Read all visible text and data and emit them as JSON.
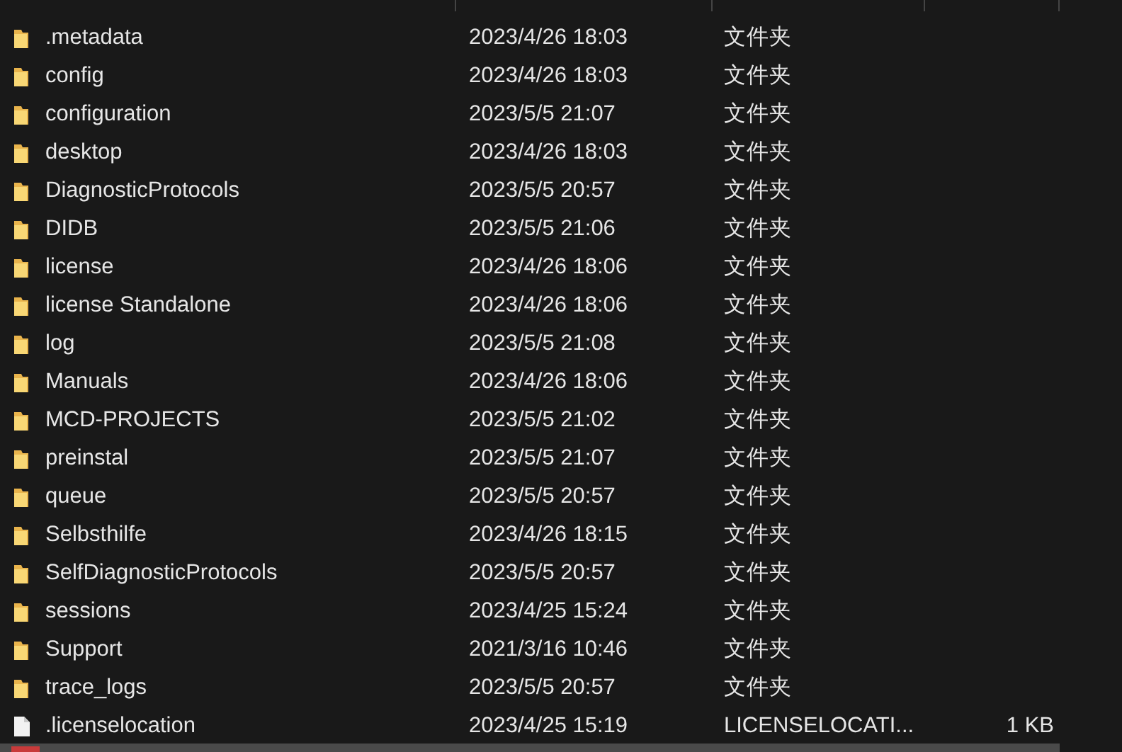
{
  "files": [
    {
      "kind": "folder",
      "name": ".metadata",
      "modified": "2023/4/26 18:03",
      "type": "文件夹"
    },
    {
      "kind": "folder",
      "name": "config",
      "modified": "2023/4/26 18:03",
      "type": "文件夹"
    },
    {
      "kind": "folder",
      "name": "configuration",
      "modified": "2023/5/5 21:07",
      "type": "文件夹"
    },
    {
      "kind": "folder",
      "name": "desktop",
      "modified": "2023/4/26 18:03",
      "type": "文件夹"
    },
    {
      "kind": "folder",
      "name": "DiagnosticProtocols",
      "modified": "2023/5/5 20:57",
      "type": "文件夹"
    },
    {
      "kind": "folder",
      "name": "DIDB",
      "modified": "2023/5/5 21:06",
      "type": "文件夹"
    },
    {
      "kind": "folder",
      "name": "license",
      "modified": "2023/4/26 18:06",
      "type": "文件夹"
    },
    {
      "kind": "folder",
      "name": "license Standalone",
      "modified": "2023/4/26 18:06",
      "type": "文件夹"
    },
    {
      "kind": "folder",
      "name": "log",
      "modified": "2023/5/5 21:08",
      "type": "文件夹"
    },
    {
      "kind": "folder",
      "name": "Manuals",
      "modified": "2023/4/26 18:06",
      "type": "文件夹"
    },
    {
      "kind": "folder",
      "name": "MCD-PROJECTS",
      "modified": "2023/5/5 21:02",
      "type": "文件夹"
    },
    {
      "kind": "folder",
      "name": "preinstal",
      "modified": "2023/5/5 21:07",
      "type": "文件夹"
    },
    {
      "kind": "folder",
      "name": "queue",
      "modified": "2023/5/5 20:57",
      "type": "文件夹"
    },
    {
      "kind": "folder",
      "name": "Selbsthilfe",
      "modified": "2023/4/26 18:15",
      "type": "文件夹"
    },
    {
      "kind": "folder",
      "name": "SelfDiagnosticProtocols",
      "modified": "2023/5/5 20:57",
      "type": "文件夹"
    },
    {
      "kind": "folder",
      "name": "sessions",
      "modified": "2023/4/25 15:24",
      "type": "文件夹"
    },
    {
      "kind": "folder",
      "name": "Support",
      "modified": "2021/3/16 10:46",
      "type": "文件夹"
    },
    {
      "kind": "folder",
      "name": "trace_logs",
      "modified": "2023/5/5 20:57",
      "type": "文件夹"
    },
    {
      "kind": "file",
      "name": ".licenselocation",
      "modified": "2023/4/25 15:19",
      "type": "LICENSELOCATI...",
      "size": "1 KB"
    }
  ]
}
